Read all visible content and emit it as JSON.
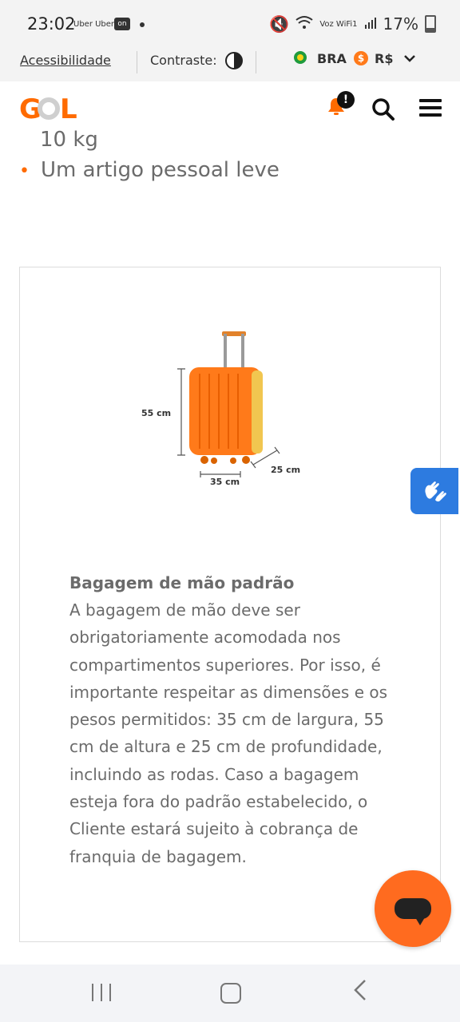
{
  "status_bar": {
    "time": "23:02",
    "apps": "Uber Uber",
    "app_icon_label": "on",
    "right_label": "Voz WiFi1",
    "battery": "17%"
  },
  "util_bar": {
    "accessibility": "Acessibilidade",
    "contrast_label": "Contraste:",
    "country": "BRA",
    "currency_symbol": "$",
    "currency": "R$"
  },
  "header": {
    "logo": "GOL",
    "notification_badge": "!"
  },
  "content": {
    "weight_tail": "10 kg",
    "bullet_text": "Um artigo pessoal leve"
  },
  "card": {
    "luggage": {
      "height_label": "55 cm",
      "width_label": "35 cm",
      "depth_label": "25 cm"
    },
    "title": "Bagagem de mão padrão",
    "body": "A bagagem de mão deve ser obrigatoriamente acomodada nos compartimentos superiores. Por isso, é importante respeitar as dimensões e os pesos permitidos: 35 cm de largura, 55 cm de altura e 25 cm de profundidade, incluindo as rodas. Caso a bagagem esteja fora do padrão estabelecido, o Cliente estará sujeito à cobrança de franquia de bagagem."
  },
  "colors": {
    "brand_orange": "#ff6b00",
    "libras_blue": "#2d7be0"
  }
}
